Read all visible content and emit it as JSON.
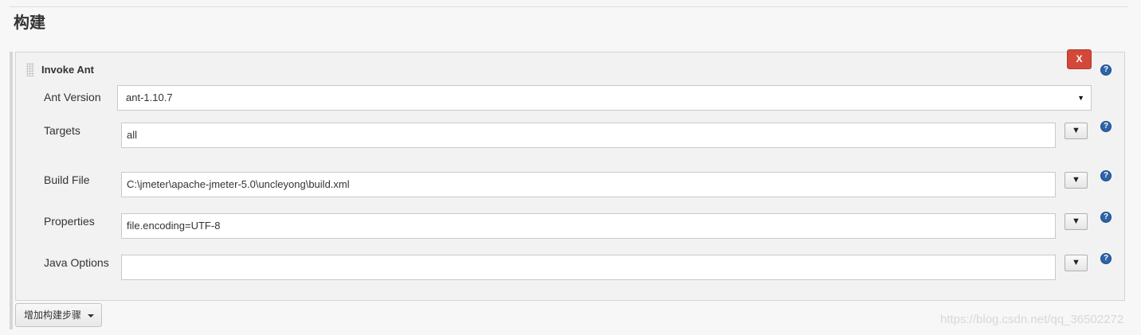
{
  "section": {
    "title": "构建"
  },
  "step": {
    "title": "Invoke Ant",
    "delete_label": "X",
    "help_symbol": "?",
    "fields": {
      "ant_version": {
        "label": "Ant Version",
        "value": "ant-1.10.7"
      },
      "targets": {
        "label": "Targets",
        "value": "all"
      },
      "build_file": {
        "label": "Build File",
        "value": "C:\\jmeter\\apache-jmeter-5.0\\uncleyong\\build.xml"
      },
      "properties": {
        "label": "Properties",
        "value": "file.encoding=UTF-8"
      },
      "java_options": {
        "label": "Java Options",
        "value": ""
      }
    },
    "expand_symbol": "▼",
    "select_arrow": "▼"
  },
  "add_step": {
    "label": "增加构建步骤"
  },
  "watermark": "https://blog.csdn.net/qq_36502272",
  "colors": {
    "delete": "#d24939",
    "help": "#2d64a8"
  },
  "icons": {
    "drag": "drag-handle-icon",
    "help": "help-icon",
    "expand": "expand-arrow-icon",
    "caret": "caret-down-icon"
  }
}
